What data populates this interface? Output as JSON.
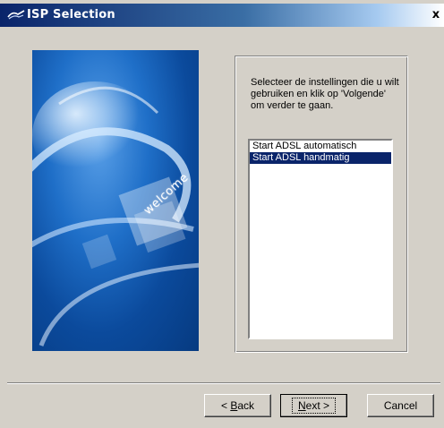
{
  "window": {
    "title": "ISP Selection",
    "close_glyph": "x"
  },
  "banner": {
    "text": "welcome"
  },
  "instructions": "Selecteer de instellingen die u wilt gebruiken en klik op 'Volgende' om verder te gaan.",
  "list": {
    "items": [
      {
        "label": "Start ADSL automatisch",
        "selected": false
      },
      {
        "label": "Start ADSL handmatig",
        "selected": true
      }
    ]
  },
  "buttons": {
    "back": {
      "prefix": "< ",
      "mnemonic": "B",
      "rest": "ack"
    },
    "next": {
      "mnemonic": "N",
      "rest": "ext",
      "suffix": " >"
    },
    "cancel": "Cancel"
  },
  "colors": {
    "titlebar_start": "#0a246a",
    "selection": "#0a246a",
    "dialog_bg": "#d4d0c8",
    "banner_blue": "#0b4a9c"
  }
}
